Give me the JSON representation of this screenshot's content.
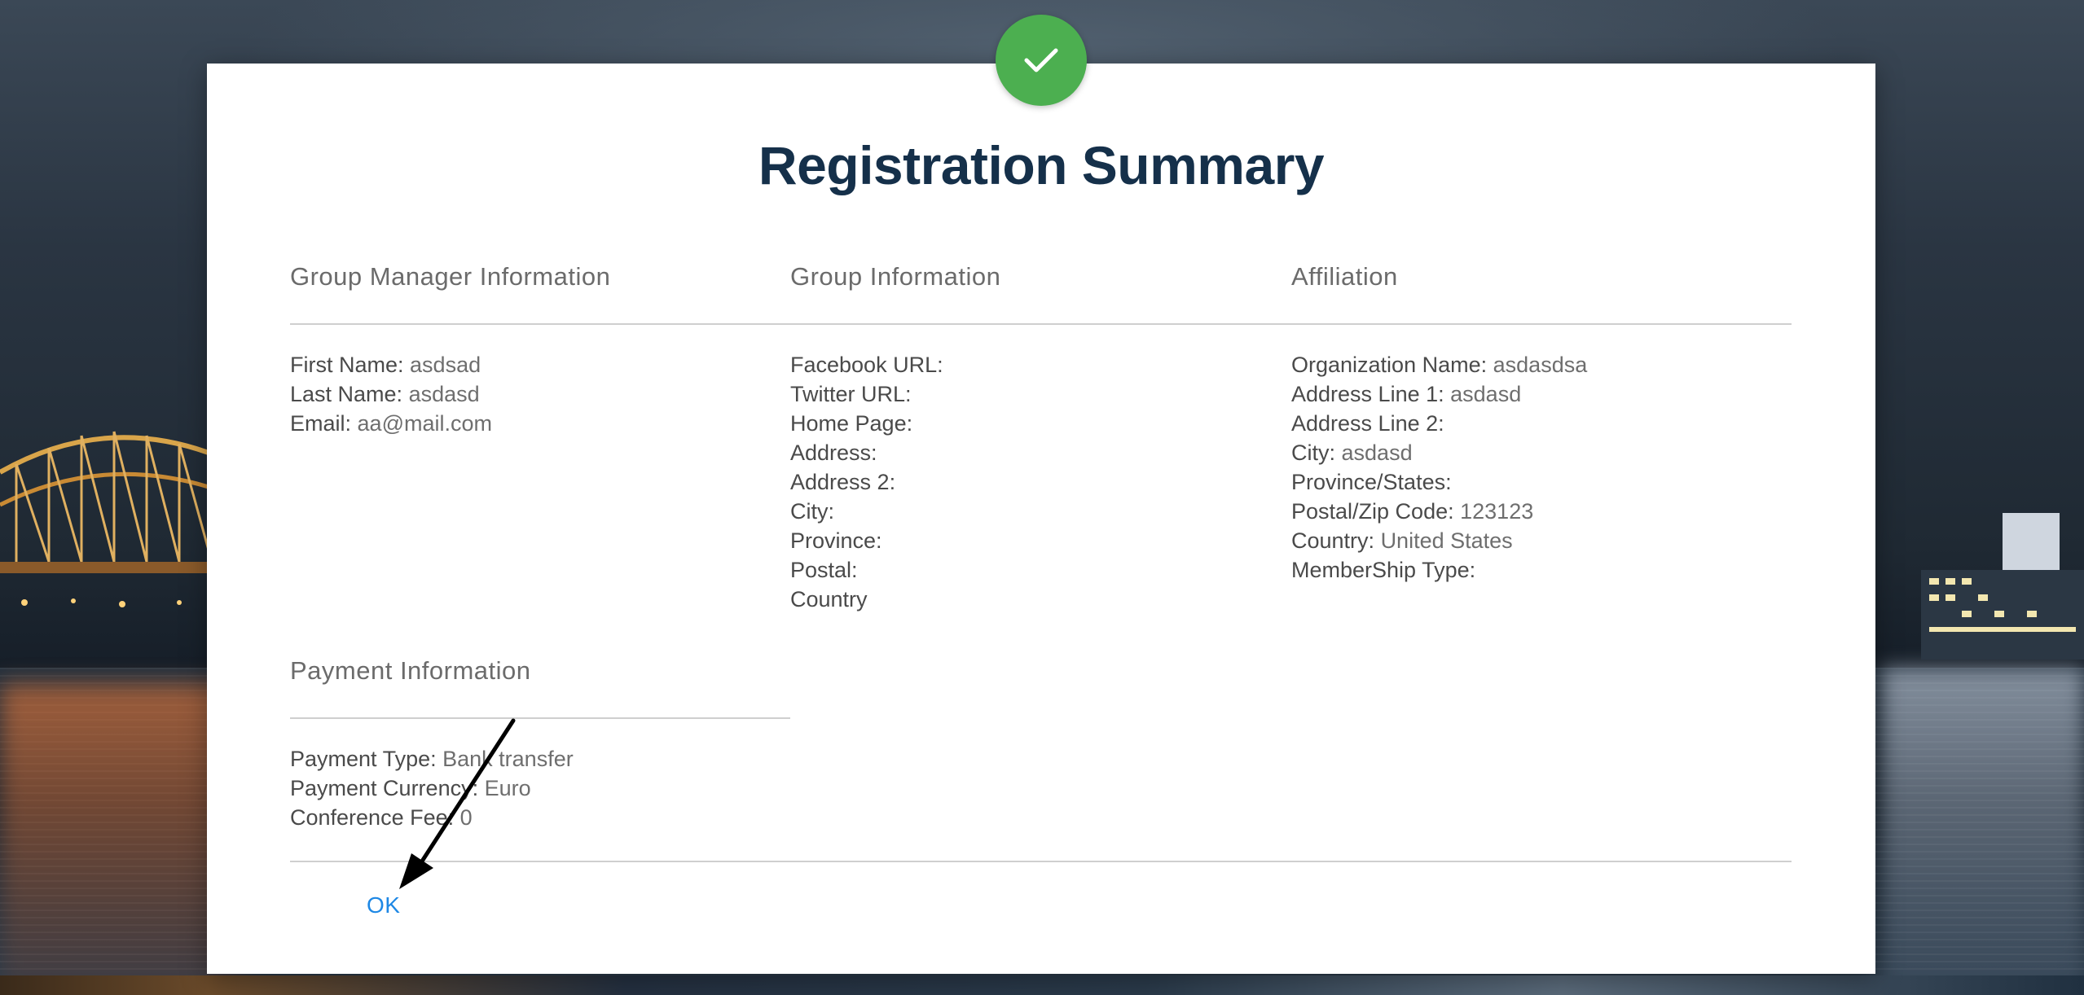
{
  "dialog": {
    "title": "Registration Summary",
    "ok_label": "OK"
  },
  "group_manager": {
    "heading": "Group Manager Information",
    "fields": [
      {
        "label": "First Name:",
        "value": "asdsad"
      },
      {
        "label": "Last Name:",
        "value": "asdasd"
      },
      {
        "label": "Email:",
        "value": "aa@mail.com"
      }
    ]
  },
  "group_info": {
    "heading": "Group Information",
    "fields": [
      {
        "label": "Facebook URL:",
        "value": ""
      },
      {
        "label": "Twitter URL:",
        "value": ""
      },
      {
        "label": "Home Page:",
        "value": ""
      },
      {
        "label": "Address:",
        "value": ""
      },
      {
        "label": "Address 2:",
        "value": ""
      },
      {
        "label": "City:",
        "value": ""
      },
      {
        "label": "Province:",
        "value": ""
      },
      {
        "label": "Postal:",
        "value": ""
      },
      {
        "label": "Country",
        "value": ""
      }
    ]
  },
  "affiliation": {
    "heading": "Affiliation",
    "fields": [
      {
        "label": "Organization Name:",
        "value": "asdasdsa"
      },
      {
        "label": "Address Line 1:",
        "value": "asdasd"
      },
      {
        "label": "Address Line 2:",
        "value": ""
      },
      {
        "label": "City:",
        "value": "asdasd"
      },
      {
        "label": "Province/States:",
        "value": ""
      },
      {
        "label": "Postal/Zip Code:",
        "value": "123123"
      },
      {
        "label": "Country:",
        "value": "United States"
      },
      {
        "label": "MemberShip Type:",
        "value": ""
      }
    ]
  },
  "payment": {
    "heading": "Payment Information",
    "fields": [
      {
        "label": "Payment Type:",
        "value": "Bank transfer"
      },
      {
        "label": "Payment Currency:",
        "value": "Euro"
      },
      {
        "label": "Conference Fee:",
        "value": "0"
      }
    ]
  },
  "icons": {
    "success": "check-icon",
    "annotation": "arrow-annotation"
  },
  "colors": {
    "success_green": "#4caf50",
    "title_navy": "#15304a",
    "link_blue": "#1e88e5"
  }
}
